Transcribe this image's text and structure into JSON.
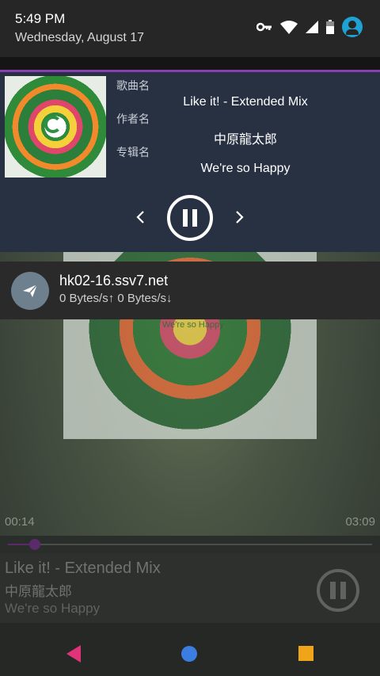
{
  "status_bar": {
    "time": "5:49 PM",
    "date": "Wednesday, August 17",
    "icons": [
      "vpn-key-icon",
      "wifi-icon",
      "cell-signal-icon",
      "battery-icon",
      "user-avatar-icon"
    ]
  },
  "music_notification": {
    "labels": {
      "song": "歌曲名",
      "artist": "作者名",
      "album": "专辑名"
    },
    "song": "Like it! - Extended Mix",
    "artist": "中原龍太郎",
    "album": "We're so Happy",
    "controls": [
      "previous",
      "pause",
      "next"
    ],
    "accent_color": "#8a3fb0"
  },
  "proxy_notification": {
    "host": "hk02-16.ssv7.net",
    "speed": "0 Bytes/s↑ 0 Bytes/s↓",
    "icon": "paper-plane-icon"
  },
  "background_player": {
    "album_art_text": "We're so Happy",
    "current_time": "00:14",
    "total_time": "03:09",
    "progress_fraction": 0.074,
    "title": "Like it! - Extended Mix",
    "artist": "中原龍太郎",
    "album": "We're so Happy"
  },
  "navigation_bar": {
    "buttons": [
      "back",
      "home",
      "recents"
    ],
    "colors": {
      "back": "#e0337a",
      "home": "#3b7de0",
      "recents": "#f0a41a"
    }
  }
}
